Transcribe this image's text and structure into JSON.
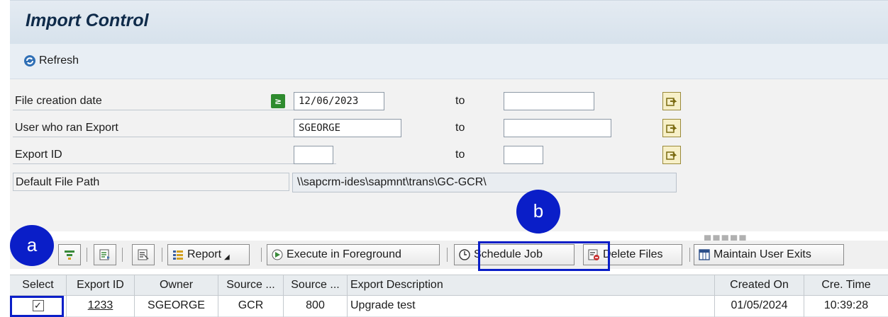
{
  "window": {
    "title": "Import Control"
  },
  "toolbar": {
    "refresh_label": "Refresh"
  },
  "selection": {
    "file_creation_date": {
      "label": "File creation date",
      "from": "12/06/2023",
      "to_label": "to",
      "to": ""
    },
    "user_who_ran_export": {
      "label": "User who ran Export",
      "from": "SGEORGE",
      "to_label": "to",
      "to": ""
    },
    "export_id": {
      "label": "Export ID",
      "from": "",
      "to_label": "to",
      "to": ""
    },
    "default_file_path": {
      "label": "Default File Path",
      "value": "\\\\sapcrm-ides\\sapmnt\\trans\\GC-GCR\\"
    }
  },
  "alv_toolbar": {
    "report_label": "Report",
    "execute_label": "Execute in Foreground",
    "schedule_label": "Schedule Job",
    "delete_label": "Delete Files",
    "maintain_label": "Maintain User Exits"
  },
  "table": {
    "headers": [
      "Select",
      "Export ID",
      "Owner",
      "Source ...",
      "Source ...",
      "Export Description",
      "Created On",
      "Cre. Time"
    ],
    "rows": [
      {
        "select": true,
        "export_id": "1233",
        "owner": "SGEORGE",
        "source1": "GCR",
        "source2": "800",
        "description": "Upgrade test",
        "created_on": "01/05/2024",
        "cre_time": "10:39:28"
      }
    ]
  },
  "annotations": {
    "marker_a": "a",
    "marker_b": "b"
  },
  "colors": {
    "annotation": "#0a1ec8",
    "title_bg": "#dde6ee",
    "status_ok": "#2e8b2e"
  }
}
